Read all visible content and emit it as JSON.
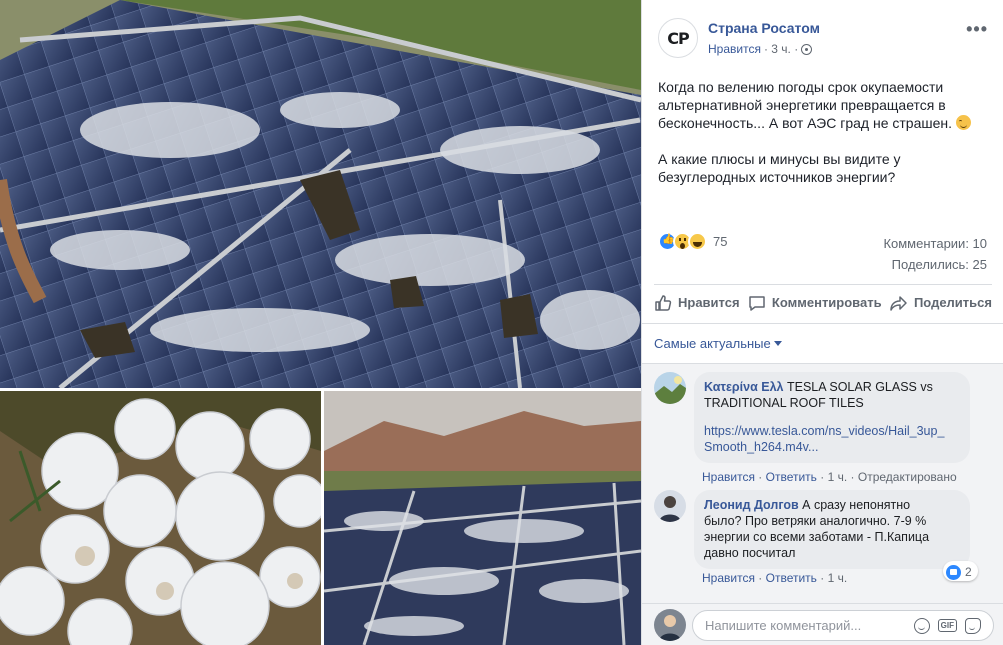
{
  "post": {
    "avatar_text": "CP",
    "page_name": "Страна Росатом",
    "meta_like": "Нравится",
    "meta_time": "· 3 ч. ·",
    "more": "•••",
    "paragraph_1": "Когда по велению погоды срок окупаемости альтернативной энергетики превращается в бесконечность... А вот АЭС град не страшен.",
    "paragraph_2": "А какие плюсы и минусы вы видите у безуглеродных источников энергии?",
    "reaction_count": "75",
    "comments_count": "Комментарии: 10",
    "shares_count": "Поделились: 25"
  },
  "actions": {
    "like": "Нравится",
    "comment": "Комментировать",
    "share": "Поделиться"
  },
  "sort": {
    "label": "Самые актуальные"
  },
  "comments": [
    {
      "author": "Κατερίνα Ελλ",
      "text": " TESLA SOLAR GLASS vs TRADITIONAL ROOF TILES",
      "link_line1": "https://www.tesla.com/ns_videos/Hail_3up_",
      "link_line2": "Smooth_h264.m4v...",
      "like": "Нравится",
      "reply": "Ответить",
      "time": "· 1 ч. ·",
      "edited": "Отредактировано"
    },
    {
      "author": "Леонид Долгов",
      "text_line1": " А сразу непонятно",
      "text_line2": "было? Про ветряки аналогично. 7-9 %",
      "text_line3": "энергии со всеми заботами - П.Капица",
      "text_line4": "давно посчитал",
      "like": "Нравится",
      "reply": "Ответить",
      "time": "· 1 ч.",
      "reaction_count": "2"
    }
  ],
  "composer": {
    "placeholder": "Напишите комментарий..."
  },
  "colors": {
    "link": "#385898",
    "meta": "#606770",
    "like_blue": "#2d88ff",
    "divider": "#dadde1"
  },
  "icons": [
    "globe-icon",
    "more-icon",
    "like-icon",
    "comment-icon",
    "share-icon",
    "caret-down-icon",
    "emoji-icon",
    "gif-icon",
    "sticker-icon"
  ]
}
